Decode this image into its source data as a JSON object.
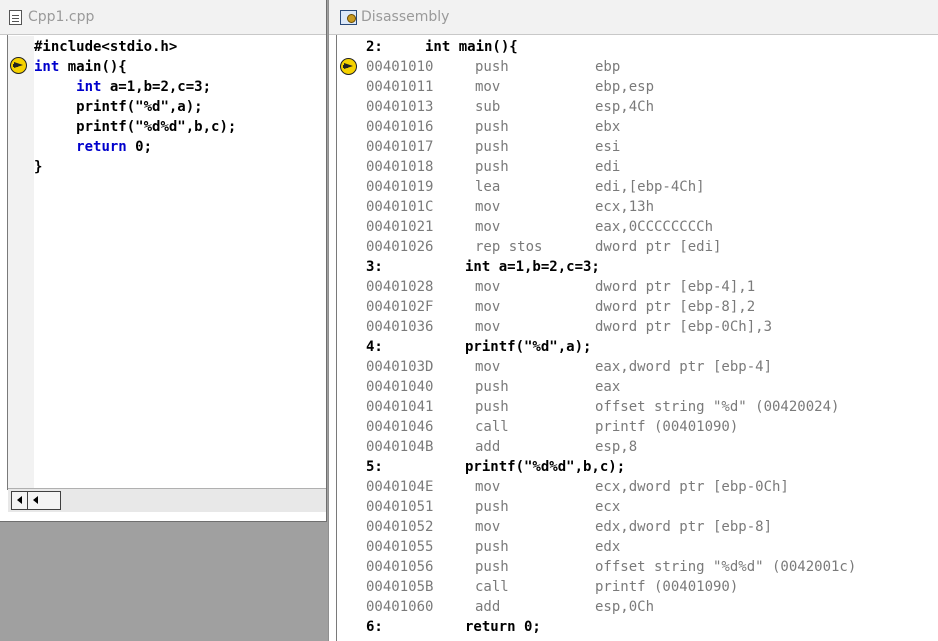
{
  "source_window": {
    "title": "Cpp1.cpp",
    "icon": "document-icon",
    "lines": [
      {
        "indent": "",
        "kw": "",
        "text": "#include<stdio.h>"
      },
      {
        "indent": "",
        "kw": "int",
        "text": " main(){"
      },
      {
        "indent": "     ",
        "kw": "int",
        "text": " a=1,b=2,c=3;"
      },
      {
        "indent": "     ",
        "kw": "",
        "text": "printf(\"%d\",a);"
      },
      {
        "indent": "     ",
        "kw": "",
        "text": "printf(\"%d%d\",b,c);"
      },
      {
        "indent": "     ",
        "kw": "return",
        "text": " 0;"
      },
      {
        "indent": "",
        "kw": "",
        "text": "}"
      }
    ]
  },
  "disasm_window": {
    "title": "Disassembly",
    "icon": "disassembly-icon",
    "lines": [
      {
        "type": "src",
        "num": "2:",
        "src": "int main(){",
        "first": true
      },
      {
        "type": "asm",
        "addr": "00401010",
        "mnem": "push",
        "oper": "ebp"
      },
      {
        "type": "asm",
        "addr": "00401011",
        "mnem": "mov",
        "oper": "ebp,esp"
      },
      {
        "type": "asm",
        "addr": "00401013",
        "mnem": "sub",
        "oper": "esp,4Ch"
      },
      {
        "type": "asm",
        "addr": "00401016",
        "mnem": "push",
        "oper": "ebx"
      },
      {
        "type": "asm",
        "addr": "00401017",
        "mnem": "push",
        "oper": "esi"
      },
      {
        "type": "asm",
        "addr": "00401018",
        "mnem": "push",
        "oper": "edi"
      },
      {
        "type": "asm",
        "addr": "00401019",
        "mnem": "lea",
        "oper": "edi,[ebp-4Ch]"
      },
      {
        "type": "asm",
        "addr": "0040101C",
        "mnem": "mov",
        "oper": "ecx,13h"
      },
      {
        "type": "asm",
        "addr": "00401021",
        "mnem": "mov",
        "oper": "eax,0CCCCCCCCh"
      },
      {
        "type": "asm",
        "addr": "00401026",
        "mnem": "rep stos",
        "oper": "dword ptr [edi]"
      },
      {
        "type": "src",
        "num": "3:",
        "src": "int a=1,b=2,c=3;"
      },
      {
        "type": "asm",
        "addr": "00401028",
        "mnem": "mov",
        "oper": "dword ptr [ebp-4],1"
      },
      {
        "type": "asm",
        "addr": "0040102F",
        "mnem": "mov",
        "oper": "dword ptr [ebp-8],2"
      },
      {
        "type": "asm",
        "addr": "00401036",
        "mnem": "mov",
        "oper": "dword ptr [ebp-0Ch],3"
      },
      {
        "type": "src",
        "num": "4:",
        "src": "printf(\"%d\",a);"
      },
      {
        "type": "asm",
        "addr": "0040103D",
        "mnem": "mov",
        "oper": "eax,dword ptr [ebp-4]"
      },
      {
        "type": "asm",
        "addr": "00401040",
        "mnem": "push",
        "oper": "eax"
      },
      {
        "type": "asm",
        "addr": "00401041",
        "mnem": "push",
        "oper": "offset string \"%d\" (00420024)"
      },
      {
        "type": "asm",
        "addr": "00401046",
        "mnem": "call",
        "oper": "printf (00401090)"
      },
      {
        "type": "asm",
        "addr": "0040104B",
        "mnem": "add",
        "oper": "esp,8"
      },
      {
        "type": "src",
        "num": "5:",
        "src": "printf(\"%d%d\",b,c);"
      },
      {
        "type": "asm",
        "addr": "0040104E",
        "mnem": "mov",
        "oper": "ecx,dword ptr [ebp-0Ch]"
      },
      {
        "type": "asm",
        "addr": "00401051",
        "mnem": "push",
        "oper": "ecx"
      },
      {
        "type": "asm",
        "addr": "00401052",
        "mnem": "mov",
        "oper": "edx,dword ptr [ebp-8]"
      },
      {
        "type": "asm",
        "addr": "00401055",
        "mnem": "push",
        "oper": "edx"
      },
      {
        "type": "asm",
        "addr": "00401056",
        "mnem": "push",
        "oper": "offset string \"%d%d\" (0042001c)"
      },
      {
        "type": "asm",
        "addr": "0040105B",
        "mnem": "call",
        "oper": "printf (00401090)"
      },
      {
        "type": "asm",
        "addr": "00401060",
        "mnem": "add",
        "oper": "esp,0Ch"
      },
      {
        "type": "src",
        "num": "6:",
        "src": "return 0;"
      }
    ]
  },
  "colors": {
    "keyword": "#0000cc",
    "address": "#7a7a7a",
    "current_line_marker": "#f6d200"
  }
}
